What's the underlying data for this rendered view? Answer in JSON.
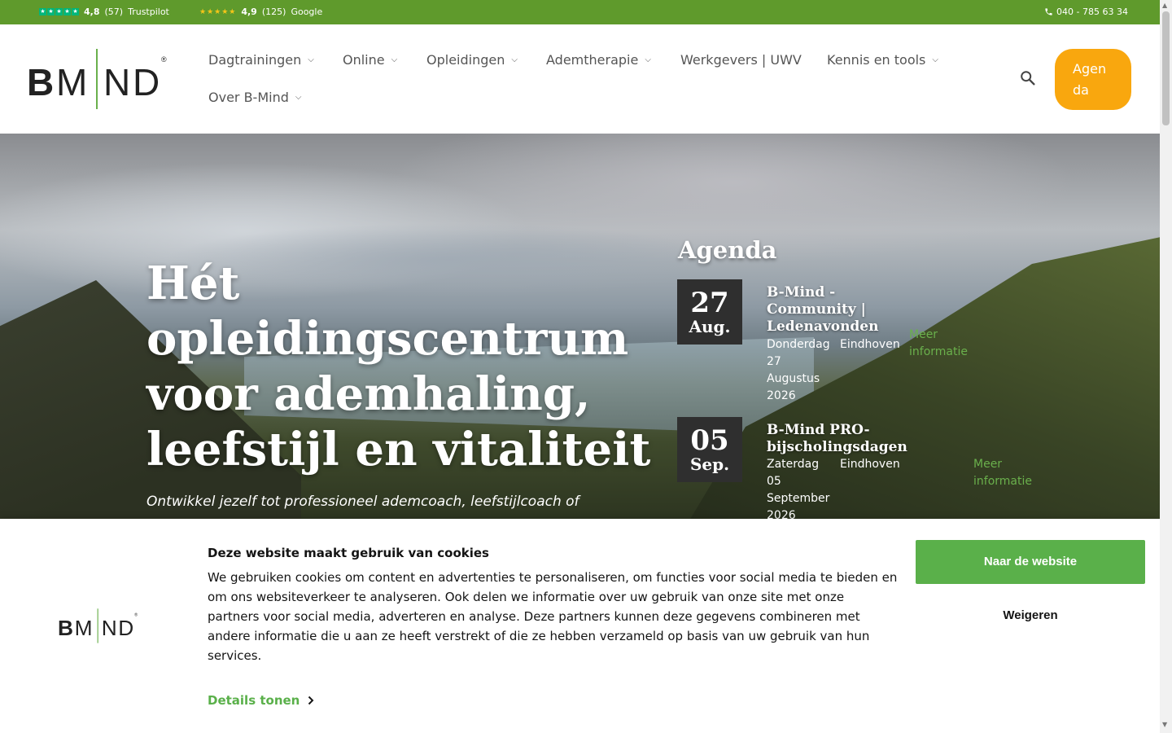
{
  "topbar": {
    "trustpilot": {
      "score": "4,8",
      "count": "(57)",
      "label": "Trustpilot"
    },
    "google": {
      "score": "4,9",
      "count": "(125)",
      "label": "Google"
    },
    "phone": "040 - 785 63 34",
    "colors": {
      "background": "#5f9a2c",
      "trustpilot_star": "#00b67a"
    }
  },
  "header": {
    "logo_text": "BMND",
    "nav": [
      {
        "label": "Dagtrainingen",
        "has_dropdown": true
      },
      {
        "label": "Online",
        "has_dropdown": true
      },
      {
        "label": "Opleidingen",
        "has_dropdown": true
      },
      {
        "label": "Ademtherapie",
        "has_dropdown": true
      },
      {
        "label": "Werkgevers | UWV",
        "has_dropdown": false
      },
      {
        "label": "Kennis en tools",
        "has_dropdown": true
      },
      {
        "label": "Over B-Mind",
        "has_dropdown": true
      }
    ],
    "agenda_button": "Agenda",
    "colors": {
      "agenda_button": "#f9a70e"
    }
  },
  "hero": {
    "title": "Hét opleidingscentrum voor ademhaling, leefstijl en vitaliteit",
    "subtitle": "Ontwikkel jezelf tot professioneel ademcoach, leefstijlcoach of"
  },
  "agenda": {
    "title": "Agenda",
    "events": [
      {
        "day": "27",
        "month": "Aug.",
        "title": "B-Mind - Community | Ledenavonden",
        "date_text": "Donderdag 27 Augustus 2026",
        "location": "Eindhoven",
        "more": "Meer informatie"
      },
      {
        "day": "05",
        "month": "Sep.",
        "title": "B-Mind PRO-bijscholingsdagen",
        "date_text": "Zaterdag 05 September 2026",
        "location": "Eindhoven",
        "more": "Meer informatie"
      }
    ]
  },
  "cookie": {
    "title": "Deze website maakt gebruik van cookies",
    "text": "We gebruiken cookies om content en advertenties te personaliseren, om functies voor social media te bieden en om ons websiteverkeer te analyseren. Ook delen we informatie over uw gebruik van onze site met onze partners voor social media, adverteren en analyse. Deze partners kunnen deze gegevens combineren met andere informatie die u aan ze heeft verstrekt of die ze hebben verzameld op basis van uw gebruik van hun services.",
    "details": "Details tonen",
    "accept": "Naar de website",
    "decline": "Weigeren",
    "colors": {
      "accept": "#5ab04a"
    }
  }
}
